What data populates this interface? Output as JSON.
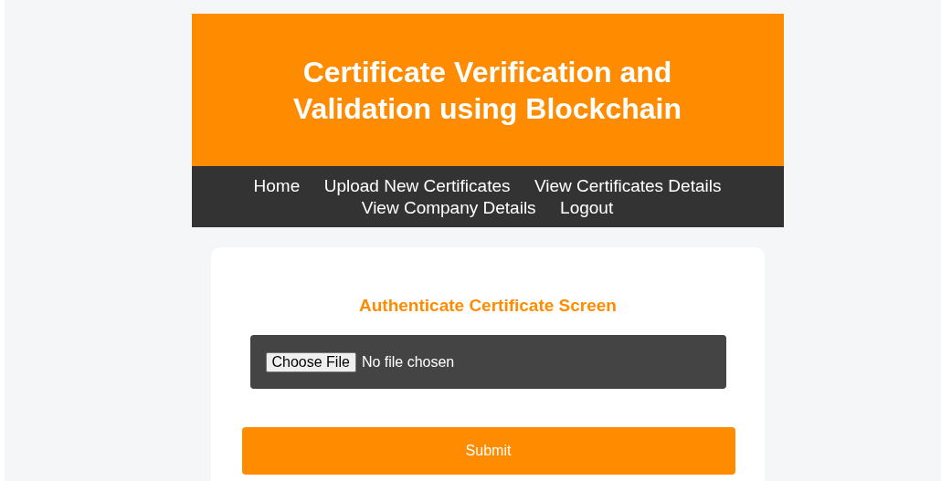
{
  "header": {
    "title": "Certificate Verification and Validation using Blockchain"
  },
  "nav": [
    {
      "label": "Home"
    },
    {
      "label": "Upload New Certificates"
    },
    {
      "label": "View Certificates Details"
    },
    {
      "label": "View Company Details"
    },
    {
      "label": "Logout"
    }
  ],
  "form": {
    "heading": "Authenticate Certificate Screen",
    "file_button": "Choose File",
    "file_status": "No file chosen",
    "submit": "Submit"
  }
}
